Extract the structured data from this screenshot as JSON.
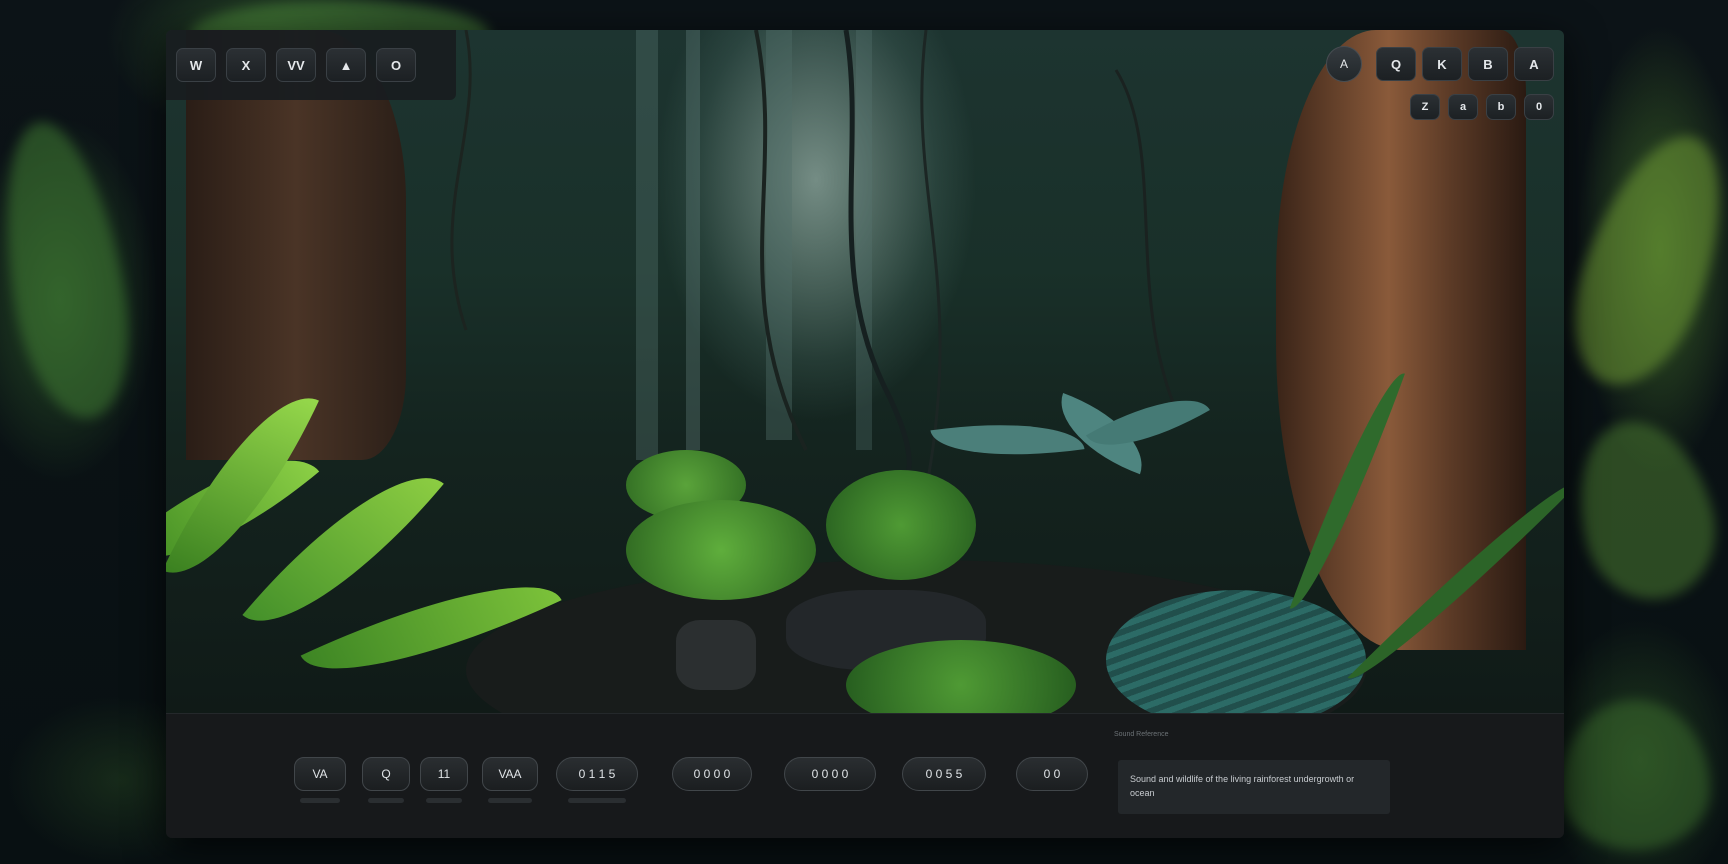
{
  "toolbar_left": {
    "buttons": [
      "W",
      "X",
      "VV",
      "▲",
      "O"
    ]
  },
  "toolbar_right": {
    "round_button": "A",
    "buttons": [
      "Q",
      "K",
      "B",
      "A"
    ],
    "small_buttons": [
      "Z",
      "a",
      "b",
      "0"
    ]
  },
  "bottom_bar": {
    "controls": [
      {
        "label": "VA",
        "shape": "rect"
      },
      {
        "label": "Q",
        "shape": "rect"
      },
      {
        "label": "11",
        "shape": "rect"
      },
      {
        "label": "VAA",
        "shape": "rect"
      },
      {
        "label": "0 1 1 5",
        "shape": "pill"
      },
      {
        "label": "0 0 0 0",
        "shape": "pill"
      },
      {
        "label": "0 0 0 0",
        "shape": "pill"
      },
      {
        "label": "0 0 5 5",
        "shape": "pill"
      },
      {
        "label": "0 0",
        "shape": "pill"
      }
    ],
    "info_header": "Sound Reference",
    "info_text": "Sound and wildlife of the living rainforest undergrowth or ocean"
  }
}
